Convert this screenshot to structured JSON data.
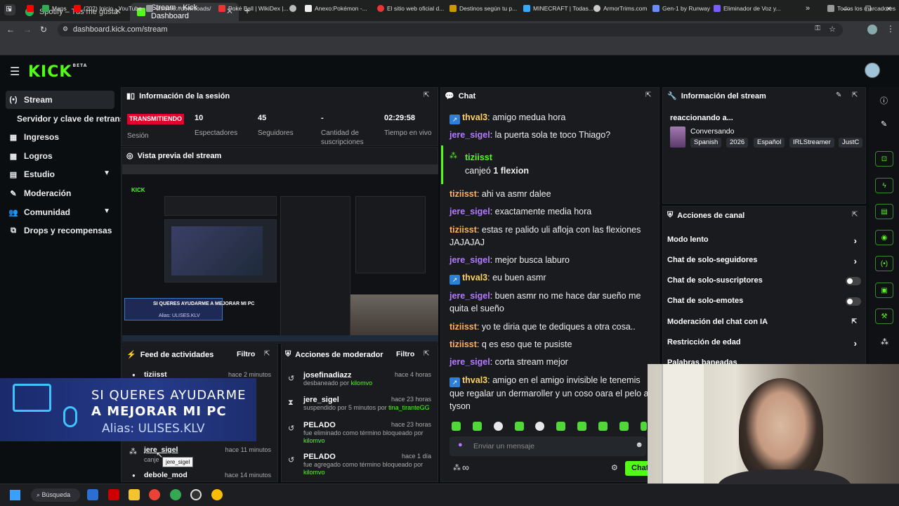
{
  "browser": {
    "tabs": [
      {
        "label": "Spotify – Tus me gusta",
        "close": "✕"
      },
      {
        "label": "Stream - Kick Dashboard",
        "close": "✕"
      }
    ],
    "new_tab": "+",
    "url": "dashboard.kick.com/stream",
    "window_controls": [
      "—",
      "❐",
      "✕"
    ],
    "bookmarks": [
      "Maps",
      "(202) Inicio - YouTube",
      "chrome://downloads/",
      "Poké Ball | WikiDex |...",
      "Anexo:Pokémon -...",
      "El sitio web oficial d...",
      "Destinos según tu p...",
      "MINECRAFT | Todas...",
      "ArmorTrims.com",
      "Gen-1 by Runway",
      "Eliminador de Voz y...",
      "»",
      "Todos los marcadores"
    ]
  },
  "header": {
    "logo": "KICK",
    "logo_badge": "BETA"
  },
  "sidebar": {
    "items": [
      {
        "label": "Stream",
        "icon": "(•)"
      },
      {
        "label": "Servidor y clave de retransmisión",
        "icon": ""
      },
      {
        "label": "Ingresos",
        "icon": "▦"
      },
      {
        "label": "Logros",
        "icon": "▩"
      },
      {
        "label": "Estudio",
        "icon": "▤",
        "chevron": "▼"
      },
      {
        "label": "Moderación",
        "icon": "✎"
      },
      {
        "label": "Comunidad",
        "icon": "👥",
        "chevron": "▼"
      },
      {
        "label": "Drops y recompensas",
        "icon": "⧉"
      }
    ]
  },
  "session": {
    "title": "Información de la sesión",
    "status": "TRANSMITIENDO",
    "stats": [
      {
        "value": "",
        "label": "Sesión"
      },
      {
        "value": "10",
        "label": "Espectadores"
      },
      {
        "value": "45",
        "label": "Seguidores"
      },
      {
        "value": "-",
        "label": "Cantidad de suscripciones"
      },
      {
        "value": "02:29:58",
        "label": "Tiempo en vivo"
      }
    ]
  },
  "preview": {
    "title": "Vista previa del stream",
    "donation": "SI QUERES AYUDARME A MEJORAR MI PC",
    "alias": "Alias: ULISES.KLV"
  },
  "activity": {
    "title": "Feed de actividades",
    "filter": "Filtro",
    "items": [
      {
        "user": "tiziisst",
        "time": "hace 2 minutos",
        "detail": ""
      },
      {
        "user": "jere_sigel",
        "time": "hace 11 minutos",
        "detail": "canje"
      },
      {
        "user": "debole_mod",
        "time": "hace 14 minutos",
        "detail": ""
      }
    ],
    "tooltip": "jere_sigel"
  },
  "overlay": {
    "line1": "SI QUERES AYUDARME",
    "line2": "A MEJORAR MI PC",
    "line3": "Alias: ULISES.KLV"
  },
  "modactions": {
    "title": "Acciones de moderador",
    "filter": "Filtro",
    "items": [
      {
        "icon": "↺",
        "name": "josefinadiazz",
        "time": "hace 4 horas",
        "desc": "desbaneado por ",
        "by": "kilomvo",
        "desc2": ""
      },
      {
        "icon": "⧗",
        "name": "jere_sigel",
        "time": "hace 23 horas",
        "desc": "suspendido por 5 minutos por ",
        "by": "tina_tiranteGG",
        "desc2": ""
      },
      {
        "icon": "↺",
        "name": "PELADO",
        "time": "hace 23 horas",
        "desc": "fue eliminado como término bloqueado por",
        "by": "kilomvo",
        "desc2": ""
      },
      {
        "icon": "↺",
        "name": "PELADO",
        "time": "hace 1 día",
        "desc": "fue agregado como término bloqueado por",
        "by": "kilomvo",
        "desc2": ""
      }
    ]
  },
  "chat": {
    "title": "Chat",
    "messages": [
      {
        "user": "thval3",
        "text": " amigo medua hora",
        "cls": "u1",
        "badge": true
      },
      {
        "user": "jere_sigel",
        "text": " la puerta sola te toco Thiago?",
        "cls": "u2",
        "badge": false
      },
      {
        "user": "tiziisst",
        "text": " ahi va asmr dalee",
        "cls": "u3",
        "badge": false
      },
      {
        "user": "jere_sigel",
        "text": " exactamente media hora",
        "cls": "u2",
        "badge": false
      },
      {
        "user": "tiziisst",
        "text": " estas re palido uli afloja con las flexiones JAJAJAJ",
        "cls": "u3",
        "badge": false
      },
      {
        "user": "jere_sigel",
        "text": " mejor busca laburo",
        "cls": "u2",
        "badge": false
      },
      {
        "user": "thval3",
        "text": " eu buen asmr",
        "cls": "u1",
        "badge": true
      },
      {
        "user": "jere_sigel",
        "text": " buen asmr no me hace dar sueño me quita el sueño",
        "cls": "u2",
        "badge": false
      },
      {
        "user": "tiziisst",
        "text": " yo te diria que te dediques a otra cosa..",
        "cls": "u3",
        "badge": false
      },
      {
        "user": "tiziisst",
        "text": " q es eso que te pusiste",
        "cls": "u3",
        "badge": false
      },
      {
        "user": "jere_sigel",
        "text": " corta stream mejor",
        "cls": "u2",
        "badge": false
      },
      {
        "user": "thval3",
        "text": " amigo en el amigo invisible le tenemis que regalar un dermaroller y un coso oara el pelo a tyson",
        "cls": "u1",
        "badge": true
      }
    ],
    "redeem": {
      "user": "tiziisst",
      "action": "canjeó",
      "reward": "1 flexion"
    },
    "input_placeholder": "Enviar un mensaje",
    "send": "Chat",
    "infinity": "∞"
  },
  "streaminfo": {
    "title": "Información del stream",
    "reacting": "reaccionando a...",
    "category": "Conversando",
    "tags": [
      "Spanish",
      "2026",
      "Español",
      "IRLStreamer",
      "JustC"
    ]
  },
  "channel": {
    "title": "Acciones de canal",
    "items": [
      {
        "label": "Modo lento",
        "control": "arrow"
      },
      {
        "label": "Chat de solo-seguidores",
        "control": "arrow"
      },
      {
        "label": "Chat de solo-suscriptores",
        "control": "toggle"
      },
      {
        "label": "Chat de solo-emotes",
        "control": "toggle"
      },
      {
        "label": "Moderación del chat con IA",
        "control": "link"
      },
      {
        "label": "Restricción de edad",
        "control": "arrow"
      },
      {
        "label": "Palabras baneadas",
        "control": "arrow"
      }
    ]
  },
  "taskbar": {
    "search": "Búsqueda"
  },
  "colors": {
    "kick_green": "#53fc18",
    "live_red": "#e4002b",
    "panel": "#191b1f"
  }
}
